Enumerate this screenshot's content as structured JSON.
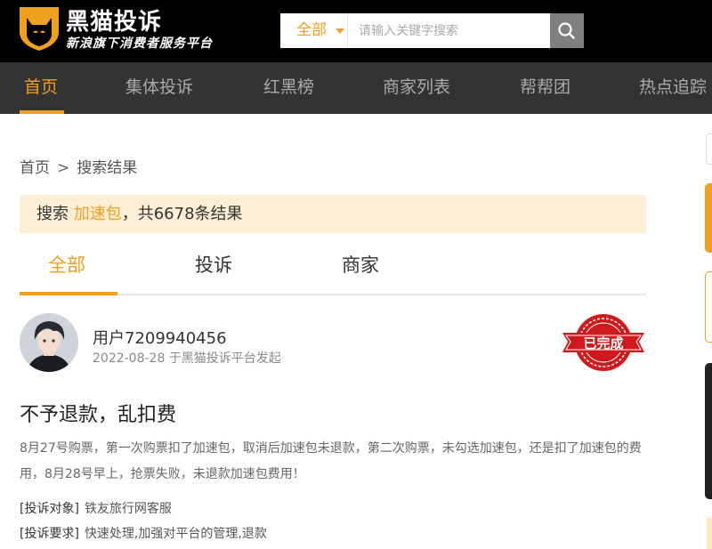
{
  "brand": {
    "name": "黑猫投诉",
    "slogan": "新浪旗下消费者服务平台"
  },
  "search": {
    "scope": "全部",
    "placeholder": "请输入关键字搜索",
    "icon": "search-icon"
  },
  "nav": {
    "items": [
      {
        "label": "首页",
        "active": true
      },
      {
        "label": "集体投诉"
      },
      {
        "label": "红黑榜"
      },
      {
        "label": "商家列表"
      },
      {
        "label": "帮帮团"
      },
      {
        "label": "热点追踪"
      }
    ]
  },
  "breadcrumb": {
    "home": "首页",
    "separator": ">",
    "current": "搜索结果"
  },
  "result": {
    "prefix": "搜索",
    "keyword": "加速包",
    "suffix": "，共6678条结果"
  },
  "tabs": [
    {
      "label": "全部",
      "active": true
    },
    {
      "label": "投诉"
    },
    {
      "label": "商家"
    }
  ],
  "complaint": {
    "username": "用户7209940456",
    "meta": "2022-08-28 于黑猫投诉平台发起",
    "status": "已完成",
    "title": "不予退款，乱扣费",
    "body": "8月27号购票，第一次购票扣了加速包，取消后加速包未退款，第二次购票，未勾选加速包，还是扣了加速包的费用，8月28号早上，抢票失败，未退款加速包费用！",
    "target_label": "[投诉对象]",
    "target_value": "铁友旅行网客服",
    "request_label": "[投诉要求]",
    "request_value": "快速处理,加强对平台的管理,退款"
  },
  "colors": {
    "accent": "#f0a020",
    "header_bg": "#000000",
    "nav_bg": "#333333",
    "banner_bg": "#fdefd6",
    "stamp_red": "#d0191c"
  }
}
